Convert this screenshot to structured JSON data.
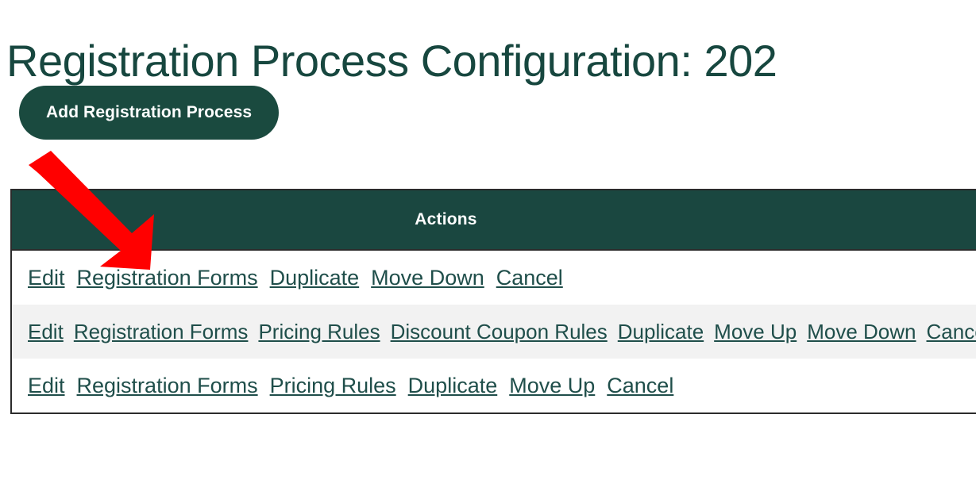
{
  "page": {
    "title": "Registration Process Configuration: 202",
    "title_truncated": true,
    "background_color": "#ffffff"
  },
  "theme": {
    "brand_green": "#1a4740",
    "button_green": "#1a4a3f",
    "link_color": "#1f4e4a",
    "header_text_color": "#ffffff",
    "stripe_color": "#f2f2f2",
    "table_border_color": "#2b2b2b",
    "annotation_color": "#ff0000"
  },
  "toolbar": {
    "add_process_label": "Add Registration Process"
  },
  "table": {
    "columns": [
      "Actions"
    ],
    "header_label": "Actions",
    "rows": [
      {
        "striped": false,
        "links": [
          "Edit",
          "Registration Forms",
          "Duplicate",
          "Move Down",
          "Cancel"
        ]
      },
      {
        "striped": true,
        "links": [
          "Edit",
          "Registration Forms",
          "Pricing Rules",
          "Discount Coupon Rules",
          "Duplicate",
          "Move Up",
          "Move Down",
          "Cancel"
        ]
      },
      {
        "striped": false,
        "links": [
          "Edit",
          "Registration Forms",
          "Pricing Rules",
          "Duplicate",
          "Move Up",
          "Cancel"
        ]
      }
    ]
  },
  "annotation": {
    "type": "arrow",
    "color": "#ff0000",
    "direction": "down-right",
    "points_to": "Registration Forms"
  }
}
